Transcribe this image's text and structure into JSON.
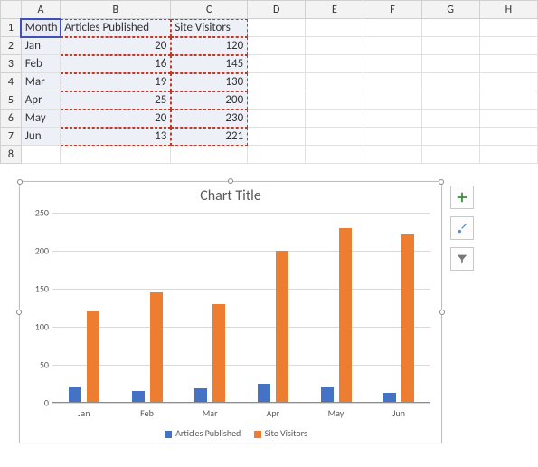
{
  "columns": [
    "A",
    "B",
    "C",
    "D",
    "E",
    "F",
    "G",
    "H"
  ],
  "headers": {
    "A": "Month",
    "B": "Articles Published",
    "C": "Site Visitors"
  },
  "rows": [
    {
      "month": "Jan",
      "articles": "20",
      "visitors": "120"
    },
    {
      "month": "Feb",
      "articles": "16",
      "visitors": "145"
    },
    {
      "month": "Mar",
      "articles": "19",
      "visitors": "130"
    },
    {
      "month": "Apr",
      "articles": "25",
      "visitors": "200"
    },
    {
      "month": "May",
      "articles": "20",
      "visitors": "230"
    },
    {
      "month": "Jun",
      "articles": "13",
      "visitors": "221"
    }
  ],
  "chart_data": {
    "type": "bar",
    "title": "Chart Title",
    "categories": [
      "Jan",
      "Feb",
      "Mar",
      "Apr",
      "May",
      "Jun"
    ],
    "series": [
      {
        "name": "Articles Published",
        "values": [
          20,
          16,
          19,
          25,
          20,
          13
        ],
        "color": "#4472c4"
      },
      {
        "name": "Site Visitors",
        "values": [
          120,
          145,
          130,
          200,
          230,
          221
        ],
        "color": "#ed7d31"
      }
    ],
    "xlabel": "",
    "ylabel": "",
    "ylim": [
      0,
      250
    ],
    "yticks": [
      0,
      50,
      100,
      150,
      200,
      250
    ],
    "legend_position": "bottom"
  }
}
